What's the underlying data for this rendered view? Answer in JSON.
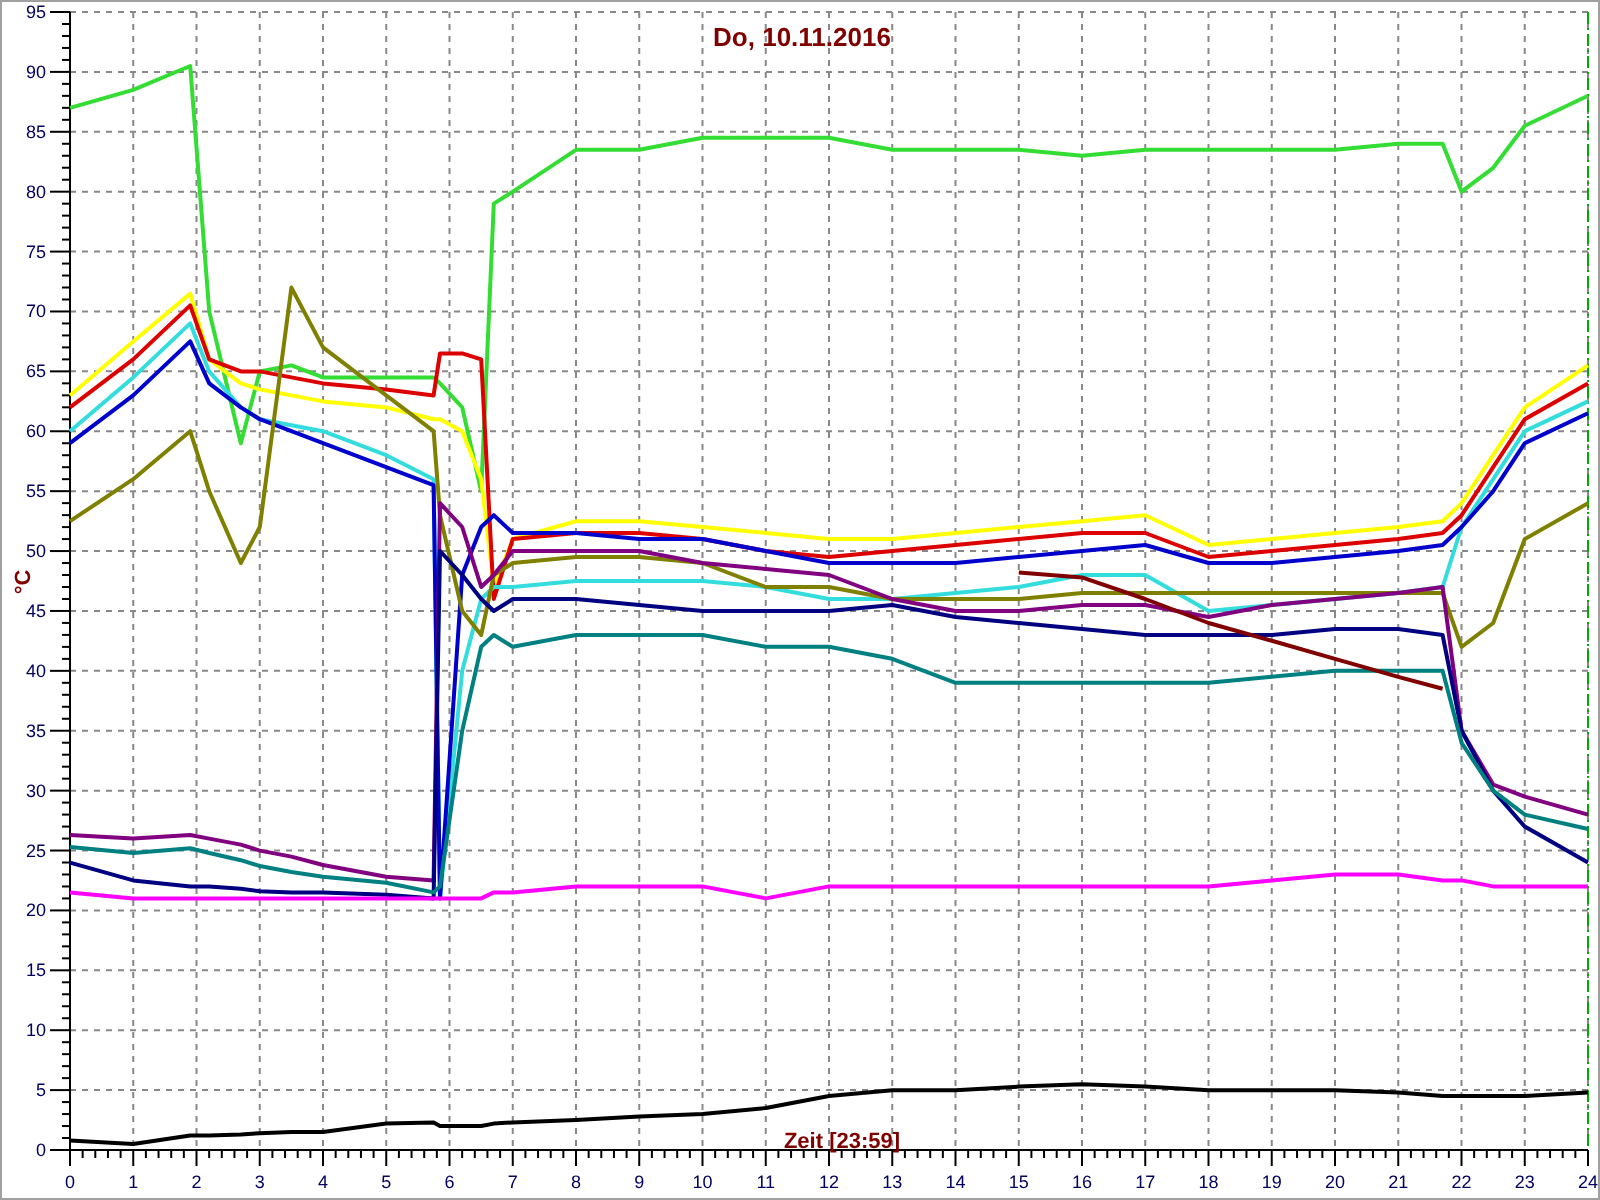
{
  "chart": {
    "chart_data": {
      "type": "line",
      "title": "Do, 10.11.2016",
      "xlabel": "Zeit [23:59]",
      "ylabel": "°C",
      "grid": true,
      "x": [
        0,
        1,
        1.9,
        2.2,
        2.7,
        3,
        3.5,
        4,
        5,
        5.75,
        5.85,
        6.2,
        6.5,
        6.7,
        7,
        8,
        9,
        10,
        11,
        12,
        13,
        14,
        15,
        16,
        17,
        18,
        19,
        20,
        21,
        21.7,
        22,
        22.5,
        23,
        24
      ],
      "series": [
        {
          "color": "#33dd33",
          "values": [
            87,
            88.5,
            90.5,
            70,
            59,
            65,
            65.5,
            64.5,
            64.5,
            64.5,
            64,
            62,
            55,
            79,
            80,
            83.5,
            83.5,
            84.5,
            84.5,
            84.5,
            83.5,
            83.5,
            83.5,
            83,
            83.5,
            83.5,
            83.5,
            83.5,
            84,
            84,
            80,
            82,
            85.5,
            88
          ]
        },
        {
          "color": "#ffff00",
          "values": [
            63,
            67.5,
            71.5,
            66,
            64,
            63.5,
            63,
            62.5,
            62,
            61,
            61,
            60,
            56,
            47,
            51,
            52.5,
            52.5,
            52,
            51.5,
            51,
            51,
            51.5,
            52,
            52.5,
            53,
            50.5,
            51,
            51.5,
            52,
            52.5,
            54,
            58,
            62,
            65.5
          ]
        },
        {
          "color": "#dd0000",
          "values": [
            62,
            66,
            70.5,
            66,
            65,
            65,
            64.5,
            64,
            63.5,
            63,
            66.5,
            66.5,
            66,
            46,
            51,
            51.5,
            51.5,
            51,
            50,
            49.5,
            50,
            50.5,
            51,
            51.5,
            51.5,
            49.5,
            50,
            50.5,
            51,
            51.5,
            53,
            57,
            61,
            64
          ]
        },
        {
          "color": "#33dddd",
          "values": [
            60,
            64.5,
            69,
            65,
            62,
            61,
            60.5,
            60,
            58,
            56,
            21,
            40,
            46,
            47,
            47,
            47.5,
            47.5,
            47.5,
            47,
            46,
            46,
            46.5,
            47,
            48,
            48,
            45,
            45.5,
            46,
            46.5,
            47,
            52,
            56,
            60,
            62.5
          ]
        },
        {
          "color": "#0000cc",
          "values": [
            59,
            63,
            67.5,
            64,
            62,
            61,
            60,
            59,
            57,
            55.5,
            21,
            48,
            52,
            53,
            51.5,
            51.5,
            51,
            51,
            50,
            49,
            49,
            49,
            49.5,
            50,
            50.5,
            49,
            49,
            49.5,
            50,
            50.5,
            52,
            55,
            59,
            61.5
          ]
        },
        {
          "color": "#808000",
          "values": [
            52.5,
            56,
            60,
            55,
            49,
            52,
            72,
            67,
            63,
            60,
            53,
            45,
            43,
            48,
            49,
            49.5,
            49.5,
            49,
            47,
            47,
            46,
            46,
            46,
            46.5,
            46.5,
            46.5,
            46.5,
            46.5,
            46.5,
            46.5,
            42,
            44,
            51,
            54
          ]
        },
        {
          "color": "#800080",
          "values": [
            26.3,
            26,
            26.3,
            26,
            25.5,
            25,
            24.5,
            23.8,
            22.8,
            22.5,
            54,
            52,
            47,
            48,
            50,
            50,
            50,
            49,
            48.5,
            48,
            46,
            45,
            45,
            45.5,
            45.5,
            44.5,
            45.5,
            46,
            46.5,
            47,
            35,
            30.5,
            29.5,
            28
          ]
        },
        {
          "color": "#000080",
          "values": [
            24,
            22.5,
            22,
            22,
            21.8,
            21.6,
            21.5,
            21.5,
            21.3,
            21,
            50,
            48,
            46,
            45,
            46,
            46,
            45.5,
            45,
            45,
            45,
            45.5,
            44.5,
            44,
            43.5,
            43,
            43,
            43,
            43.5,
            43.5,
            43,
            35,
            30,
            27,
            24
          ]
        },
        {
          "color": "#008080",
          "values": [
            25.3,
            24.8,
            25.2,
            24.8,
            24.2,
            23.7,
            23.2,
            22.8,
            22.3,
            21.5,
            22,
            35,
            42,
            43,
            42,
            43,
            43,
            43,
            42,
            42,
            41,
            39,
            39,
            39,
            39,
            39,
            39.5,
            40,
            40,
            40,
            34,
            30,
            28,
            26.8
          ]
        },
        {
          "color": "#ff00ff",
          "values": [
            21.5,
            21,
            21,
            21,
            21,
            21,
            21,
            21,
            21,
            21,
            21,
            21,
            21,
            21.5,
            21.5,
            22,
            22,
            22,
            21,
            22,
            22,
            22,
            22,
            22,
            22,
            22,
            22.5,
            23,
            23,
            22.5,
            22.5,
            22,
            22,
            22
          ]
        },
        {
          "color": "#800000",
          "values": [
            null,
            null,
            null,
            null,
            null,
            null,
            null,
            null,
            null,
            null,
            null,
            null,
            null,
            null,
            null,
            null,
            null,
            null,
            null,
            null,
            null,
            null,
            48.2,
            47.8,
            46,
            44,
            42.5,
            41,
            39.5,
            38.5,
            null,
            null,
            null,
            null
          ]
        },
        {
          "color": "#000000",
          "values": [
            0.8,
            0.5,
            1.2,
            1.2,
            1.3,
            1.4,
            1.5,
            1.5,
            2.2,
            2.3,
            2,
            2,
            2,
            2.2,
            2.3,
            2.5,
            2.8,
            3,
            3.5,
            4.5,
            5,
            5,
            5.3,
            5.5,
            5.3,
            5,
            5,
            5,
            4.8,
            4.5,
            4.5,
            4.5,
            4.5,
            4.8
          ]
        }
      ],
      "xlim": [
        0,
        24
      ],
      "ylim": [
        0,
        95
      ],
      "xticks": [
        0,
        1,
        2,
        3,
        4,
        5,
        6,
        7,
        8,
        9,
        10,
        11,
        12,
        13,
        14,
        15,
        16,
        17,
        18,
        19,
        20,
        21,
        22,
        23,
        24
      ],
      "yticks": [
        0,
        5,
        10,
        15,
        20,
        25,
        30,
        35,
        40,
        45,
        50,
        55,
        60,
        65,
        70,
        75,
        80,
        85,
        90,
        95
      ]
    }
  }
}
